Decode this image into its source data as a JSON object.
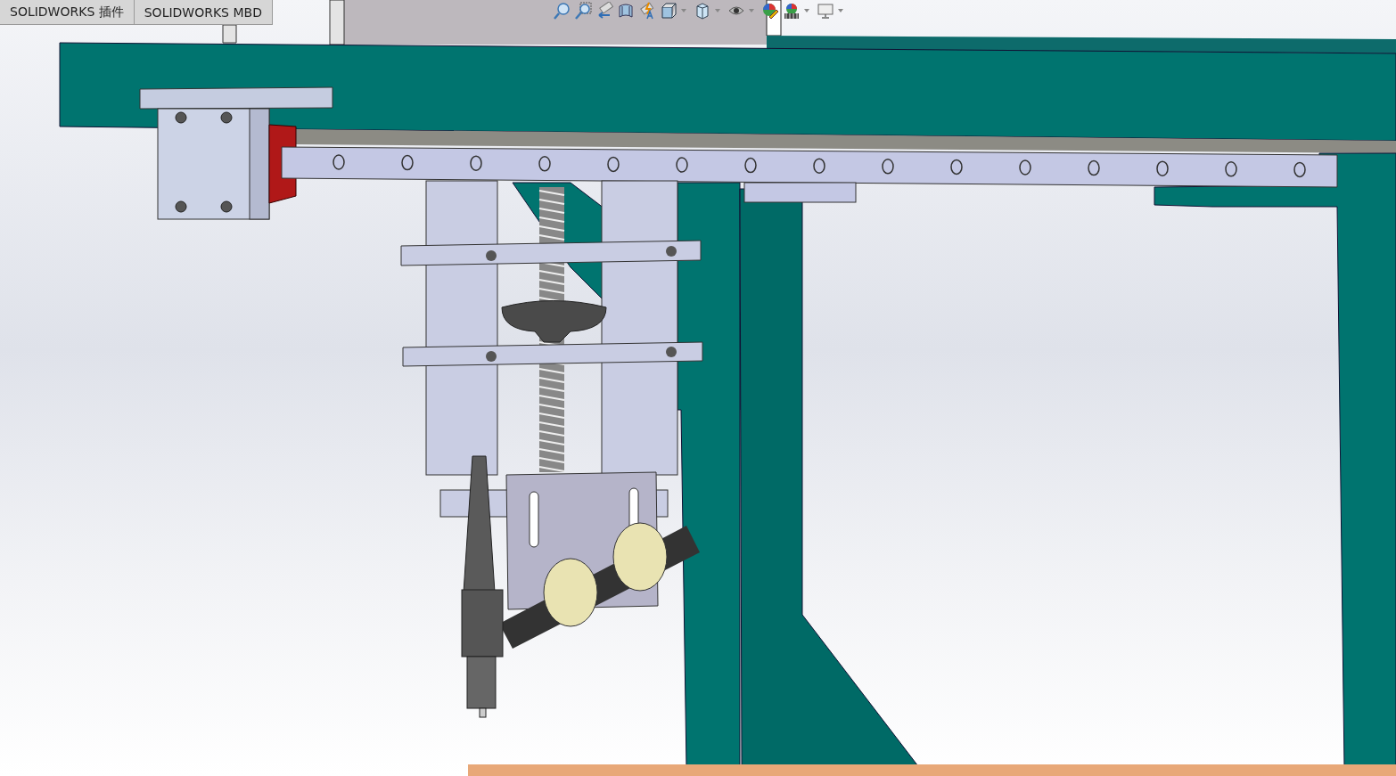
{
  "tabs": [
    {
      "label": "SOLIDWORKS 插件"
    },
    {
      "label": "SOLIDWORKS MBD"
    }
  ]
}
